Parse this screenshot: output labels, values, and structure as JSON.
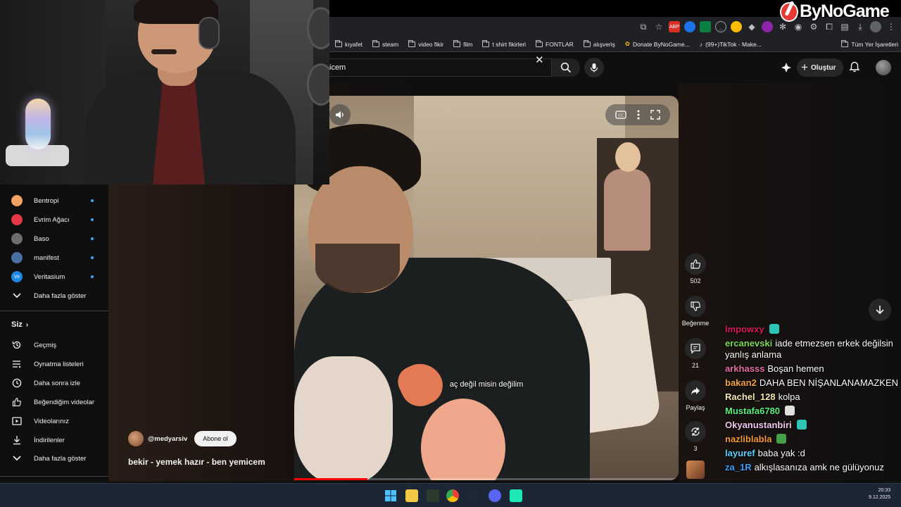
{
  "brand": {
    "name": "ByNoGame"
  },
  "bookmarks": {
    "items": [
      "kıyafet",
      "steam",
      "video fikir",
      "film",
      "t shirt fikirleri",
      "FONTLAR",
      "alışveriş",
      "Donate ByNoGame...",
      "(99+)TikTok - Make..."
    ],
    "all_label": "Tüm Yer İşaretleri"
  },
  "header": {
    "search_query": "icem",
    "create_label": "Oluştur"
  },
  "sidebar": {
    "subscriptions": [
      {
        "label": "Bentropi",
        "color": "#f4a261"
      },
      {
        "label": "Evrim Ağacı",
        "color": "#e63946"
      },
      {
        "label": "Baso",
        "color": "#6d6d6d"
      },
      {
        "label": "manifest",
        "color": "#4a6fa5"
      },
      {
        "label": "Veritasium",
        "color": "#1e88e5",
        "initials": "Ve"
      }
    ],
    "show_more": "Daha fazla göster",
    "you_heading": "Siz",
    "you_items": [
      {
        "label": "Geçmiş",
        "icon": "history-icon"
      },
      {
        "label": "Oynatma listeleri",
        "icon": "playlists-icon"
      },
      {
        "label": "Daha sonra izle",
        "icon": "watch-later-icon"
      },
      {
        "label": "Beğendiğim videolar",
        "icon": "liked-videos-icon"
      },
      {
        "label": "Videolarınız",
        "icon": "your-videos-icon"
      },
      {
        "label": "İndirilenler",
        "icon": "downloads-icon"
      }
    ],
    "show_more_2": "Daha fazla göster"
  },
  "short": {
    "channel": "@medyarsiv",
    "subscribe_label": "Abone ol",
    "title": "bekir - yemek hazır - ben yemicem",
    "subtitle": "aç değil misin değilim",
    "progress_fraction": 0.19,
    "likes": "502",
    "dislike_label": "Beğenme",
    "comments": "21",
    "share_label": "Paylaş",
    "remix_count": "3"
  },
  "chat": [
    {
      "user": "lmpowxy",
      "color": "#d81b60",
      "text": "",
      "emote": "#2ec4b6"
    },
    {
      "user": "ercanevski",
      "color": "#7ed957",
      "text": "iade etmezsen erkek değilsin yanlış anlama"
    },
    {
      "user": "arkhasss",
      "color": "#e36fa5",
      "text": "Boşan hemen"
    },
    {
      "user": "bakan2",
      "color": "#f4a340",
      "text": "DAHA BEN NİŞANLANAMAZKEN"
    },
    {
      "user": "Rachel_128",
      "color": "#f6e7b4",
      "text": "kolpa"
    },
    {
      "user": "Mustafa6780",
      "color": "#5cf07a",
      "text": "",
      "emote": "#e0e0e0"
    },
    {
      "user": "Okyanustanbiri",
      "color": "#f0c8f0",
      "text": "",
      "emote": "#2ec4b6"
    },
    {
      "user": "nazliblabla",
      "color": "#f59a3a",
      "text": "",
      "emote": "#43a047"
    },
    {
      "user": "layuref",
      "color": "#5ad2ff",
      "text": "baba yak :d"
    },
    {
      "user": "za_1R",
      "color": "#3aa0ff",
      "text": "alkışlasanıza amk ne gülüyonuz"
    }
  ],
  "taskbar": {
    "time": "20:33",
    "date": "9.12.2025"
  },
  "colors": {
    "accent": "#3ea6ff",
    "progress": "#ff0000",
    "background": "#0f0f0f"
  }
}
